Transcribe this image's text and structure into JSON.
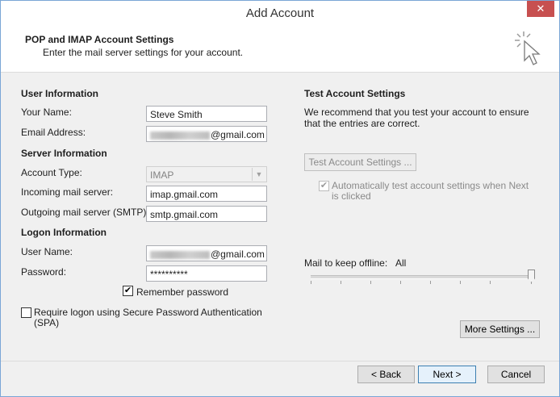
{
  "window": {
    "title": "Add Account",
    "close_glyph": "✕"
  },
  "header": {
    "title": "POP and IMAP Account Settings",
    "subtitle": "Enter the mail server settings for your account."
  },
  "user_info": {
    "heading": "User Information",
    "your_name_label": "Your Name:",
    "your_name_value": "Steve Smith",
    "email_label": "Email Address:",
    "email_suffix": "@gmail.com"
  },
  "server_info": {
    "heading": "Server Information",
    "account_type_label": "Account Type:",
    "account_type_value": "IMAP",
    "incoming_label": "Incoming mail server:",
    "incoming_value": "imap.gmail.com",
    "outgoing_label": "Outgoing mail server (SMTP):",
    "outgoing_value": "smtp.gmail.com"
  },
  "logon_info": {
    "heading": "Logon Information",
    "username_label": "User Name:",
    "username_suffix": "@gmail.com",
    "password_label": "Password:",
    "password_value": "**********",
    "remember_label": "Remember password",
    "remember_checked": true,
    "spa_label": "Require logon using Secure Password Authentication (SPA)",
    "spa_checked": false
  },
  "test_settings": {
    "heading": "Test Account Settings",
    "description": "We recommend that you test your account to ensure that the entries are correct.",
    "button_label": "Test Account Settings ...",
    "auto_test_label": "Automatically test account settings when Next is clicked",
    "auto_test_checked": true
  },
  "offline": {
    "label": "Mail to keep offline:",
    "value": "All"
  },
  "buttons": {
    "more_settings": "More Settings ...",
    "back": "< Back",
    "next": "Next >",
    "cancel": "Cancel"
  },
  "icons": {
    "close": "close-icon",
    "cursor": "pointer-cursor-icon",
    "checkmark": "checkmark-icon",
    "dropdown": "chevron-down-icon"
  }
}
